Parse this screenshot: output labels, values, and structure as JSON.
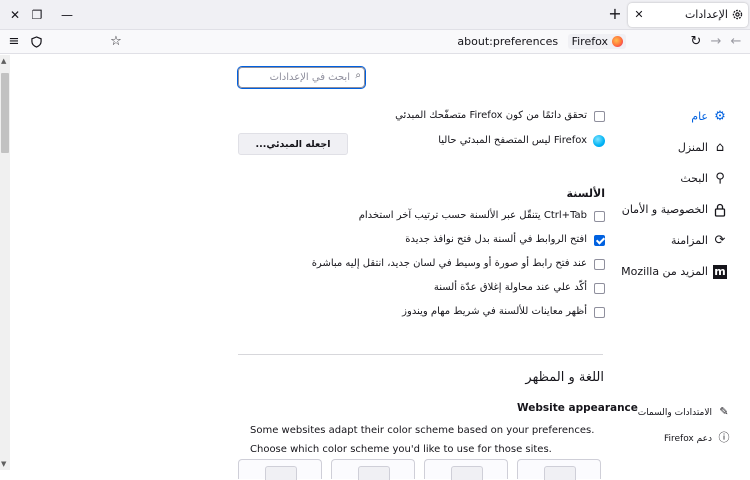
{
  "window": {
    "close_glyph": "✕",
    "restore_glyph": "❐",
    "minimize_glyph": "—",
    "new_tab_glyph": "+"
  },
  "tab": {
    "title": "الإعدادات",
    "close_glyph": "✕",
    "icon": "gear-icon"
  },
  "toolbar": {
    "back_icon": "arrow-left-icon",
    "forward_icon": "arrow-right-icon",
    "reload_icon": "reload-icon",
    "url": "about:preferences",
    "brand": "Firefox",
    "bookmark_icon": "star-icon",
    "pocket_icon": "shield-icon",
    "menu_icon": "hamburger-menu-icon"
  },
  "search": {
    "placeholder": "ابحث في الإعدادات"
  },
  "nav": {
    "items": [
      {
        "label": "عام",
        "icon": "gear-icon",
        "selected": true
      },
      {
        "label": "المنزل",
        "icon": "home-icon"
      },
      {
        "label": "البحث",
        "icon": "search-icon"
      },
      {
        "label": "الخصوصية و الأمان",
        "icon": "lock-icon"
      },
      {
        "label": "المزامنة",
        "icon": "sync-icon"
      },
      {
        "label": "المزيد من Mozilla",
        "icon": "mozilla-icon"
      }
    ],
    "footer": [
      {
        "label": "الامتدادات والسمات",
        "icon": "puzzle-icon"
      },
      {
        "label": "دعم Firefox",
        "icon": "help-icon"
      }
    ]
  },
  "general": {
    "default_check_label": "تحقق دائمًا من كون Firefox متصفّحك المبدئي",
    "default_status": "Firefox ليس المتصفح المبدئي حاليا",
    "make_default_button": "اجعله المبدئي...",
    "tabs_heading": "الألسنة",
    "tab_options": [
      {
        "label": "Ctrl+Tab يتنقّل عبر الألسنة حسب ترتيب آخر استخدام",
        "checked": false
      },
      {
        "label": "افتح الروابط في ألسنة بدل فتح نوافذ جديدة",
        "checked": true
      },
      {
        "label": "عند فتح رابط أو صورة أو وسيط في لسان جديد، انتقل إليه مباشرة",
        "checked": false
      },
      {
        "label": "أكّد علي عند محاولة إغلاق عدّة ألسنة",
        "checked": false
      },
      {
        "label": "أظهر معاينات للألسنة في شريط مهام ويندوز",
        "checked": false
      }
    ],
    "lang_heading": "اللغة و المظهر",
    "appearance_heading": "Website appearance",
    "appearance_desc": "Some websites adapt their color scheme based on your preferences. Choose which color scheme you'd like to use for those sites."
  }
}
